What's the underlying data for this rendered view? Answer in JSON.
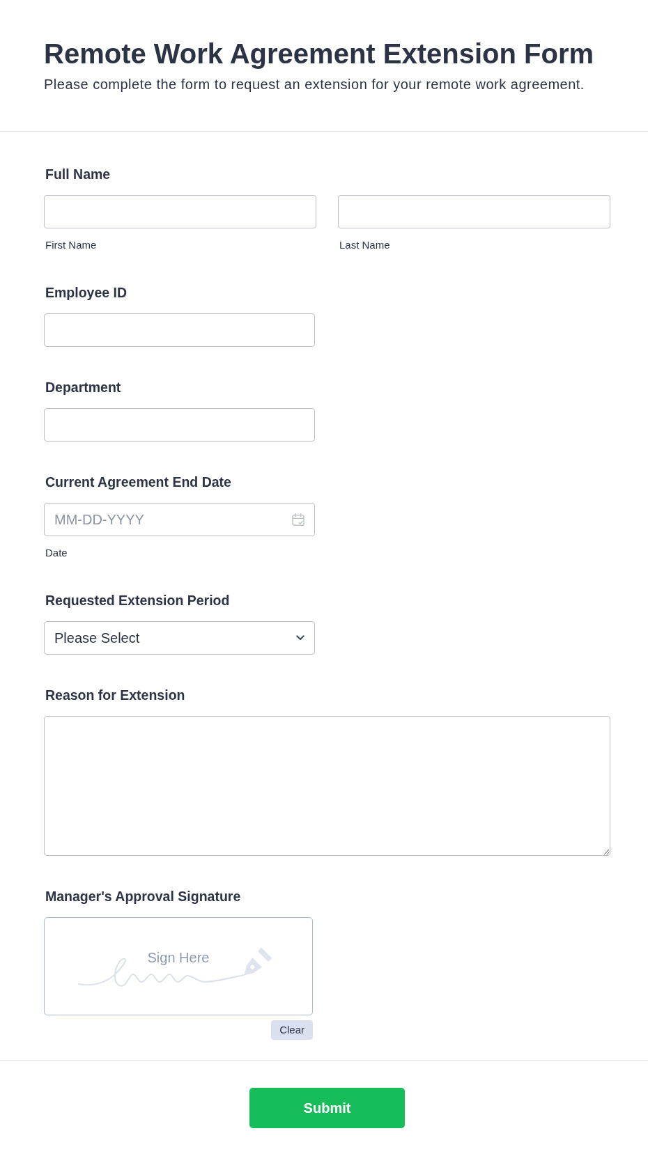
{
  "header": {
    "title": "Remote Work Agreement Extension Form",
    "subtitle": "Please complete the form to request an extension for your remote work agreement."
  },
  "fields": [
    {
      "kind": "name",
      "label": "Full Name",
      "inputs": [
        {
          "sublabel": "First Name"
        },
        {
          "sublabel": "Last Name"
        }
      ]
    },
    {
      "kind": "text",
      "label": "Employee ID"
    },
    {
      "kind": "text",
      "label": "Department"
    },
    {
      "kind": "date",
      "label": "Current Agreement End Date",
      "placeholder": "MM-DD-YYYY",
      "sublabel": "Date"
    },
    {
      "kind": "select",
      "label": "Requested Extension Period",
      "value": "Please Select"
    },
    {
      "kind": "textarea",
      "label": "Reason for Extension"
    },
    {
      "kind": "signature",
      "label": "Manager's Approval Signature",
      "placeholder": "Sign Here",
      "clear_button": "Clear"
    }
  ],
  "submit_button": "Submit"
}
